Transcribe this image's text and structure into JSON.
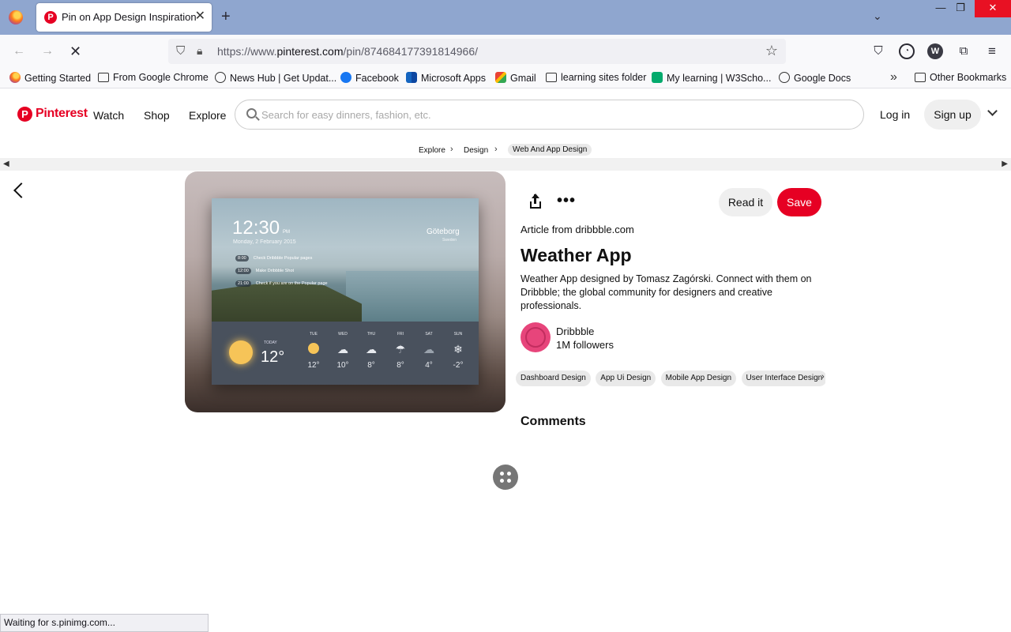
{
  "browser": {
    "tab_title": "Pin on App Design Inspiration",
    "url_prefix": "https://www.",
    "url_domain": "pinterest.com",
    "url_path": "/pin/874684177391814966/",
    "status_text": "Waiting for s.pinimg.com...",
    "bookmarks": [
      {
        "label": "Getting Started",
        "icon": "firefox-icon"
      },
      {
        "label": "From Google Chrome",
        "icon": "folder-icon"
      },
      {
        "label": "News Hub | Get Updat...",
        "icon": "globe-icon"
      },
      {
        "label": "Facebook",
        "icon": "facebook-icon"
      },
      {
        "label": "Microsoft Apps",
        "icon": "microsoft-icon"
      },
      {
        "label": "Gmail",
        "icon": "gmail-icon"
      },
      {
        "label": "learning sites folder",
        "icon": "folder-icon"
      },
      {
        "label": "My learning | W3Scho...",
        "icon": "w3schools-icon"
      },
      {
        "label": "Google Docs",
        "icon": "globe-icon"
      }
    ],
    "other_bookmarks": "Other Bookmarks"
  },
  "header": {
    "logo_text": "Pinterest",
    "nav": [
      "Watch",
      "Shop",
      "Explore"
    ],
    "search_placeholder": "Search for easy dinners, fashion, etc.",
    "login_label": "Log in",
    "signup_label": "Sign up"
  },
  "breadcrumb": [
    "Explore",
    "Design",
    "Web And App Design"
  ],
  "pin": {
    "read_label": "Read it",
    "save_label": "Save",
    "article_from_prefix": "Article from ",
    "article_source": "dribbble.com",
    "title": "Weather App",
    "description": "Weather App designed by Tomasz Zagórski. Connect with them on Dribbble; the global community for designers and creative professionals.",
    "creator_name": "Dribbble",
    "creator_followers": "1M followers",
    "tags": [
      "Dashboard Design",
      "App Ui Design",
      "Mobile App Design",
      "User Interface Design"
    ],
    "comments_heading": "Comments"
  },
  "mockup": {
    "time": "12:30",
    "ampm": "PM",
    "date": "Monday, 2 February 2015",
    "city": "Göteborg",
    "country": "Sweden",
    "events": [
      {
        "time": "8:00",
        "text": "Check Dribbble Popular pages"
      },
      {
        "time": "12:00",
        "text": "Make Dribbble Shot"
      },
      {
        "time": "21:00",
        "text": "Check if you are on the Popular page"
      }
    ],
    "today_label": "TODAY",
    "today_temp": "12°",
    "forecast": [
      {
        "day": "TUE",
        "temp": "12°",
        "icon": "sun"
      },
      {
        "day": "WED",
        "temp": "10°",
        "icon": "partly-cloudy"
      },
      {
        "day": "THU",
        "temp": "8°",
        "icon": "cloud"
      },
      {
        "day": "FRI",
        "temp": "8°",
        "icon": "rain"
      },
      {
        "day": "SAT",
        "temp": "4°",
        "icon": "cloud"
      },
      {
        "day": "SUN",
        "temp": "-2°",
        "icon": "snow"
      }
    ]
  },
  "colors": {
    "brand_red": "#e60023",
    "tab_bar": "#8fa6cf"
  }
}
